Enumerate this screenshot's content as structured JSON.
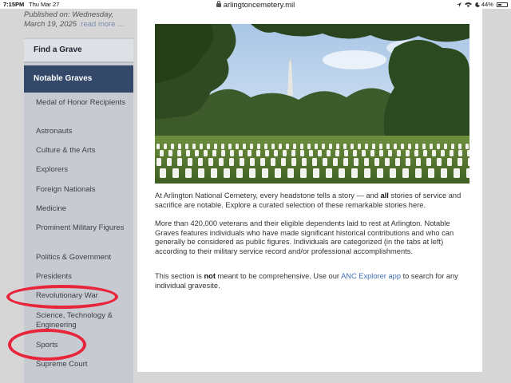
{
  "status_bar": {
    "time": "7:15PM",
    "date": "Thu Mar 27",
    "url": "arlingtoncemetery.mil",
    "battery": "44%",
    "battery_level": 0.44
  },
  "sidebar": {
    "published_line1": "Published on: Wednesday,",
    "published_line2": "March 19, 2025",
    "read_more": "read more ...",
    "find_a_grave": "Find a Grave",
    "notable_graves": "Notable Graves",
    "items": [
      {
        "label": "Medal of Honor Recipients"
      },
      {
        "label": "Astronauts"
      },
      {
        "label": "Culture & the Arts"
      },
      {
        "label": "Explorers"
      },
      {
        "label": "Foreign Nationals"
      },
      {
        "label": "Medicine"
      },
      {
        "label": "Prominent Military Figures"
      },
      {
        "label": "Politics & Government"
      },
      {
        "label": "Presidents"
      },
      {
        "label": "Revolutionary War"
      },
      {
        "label": "Science, Technology & Engineering"
      },
      {
        "label": "Sports"
      },
      {
        "label": "Supreme Court"
      }
    ]
  },
  "main": {
    "hero_alt": "Rows of white headstones with the Washington Monument in the distance",
    "para1_a": "At Arlington National Cemetery, every headstone tells a story — and ",
    "para1_b": "all",
    "para1_c": " stories of service and sacrifice are notable. Explore a curated selection of these remarkable stories here.",
    "para2": "More than 420,000 veterans and their eligible dependents laid to rest at Arlington. Notable Graves features individuals who have made significant historical contributions and who can generally be considered as public figures. Individuals are categorized (in the tabs at left) according to their military service record and/or professional accomplishments.",
    "para3_a": "This section is ",
    "para3_b": "not",
    "para3_c": " meant to be comprehensive. Use our ",
    "para3_link": "ANC Explorer app",
    "para3_d": " to search for any individual gravesite."
  },
  "colors": {
    "nav_active": "#34486a",
    "sidebar_bg": "#c7cbd1",
    "annotation": "#e8263b",
    "link": "#3f6fb5"
  }
}
